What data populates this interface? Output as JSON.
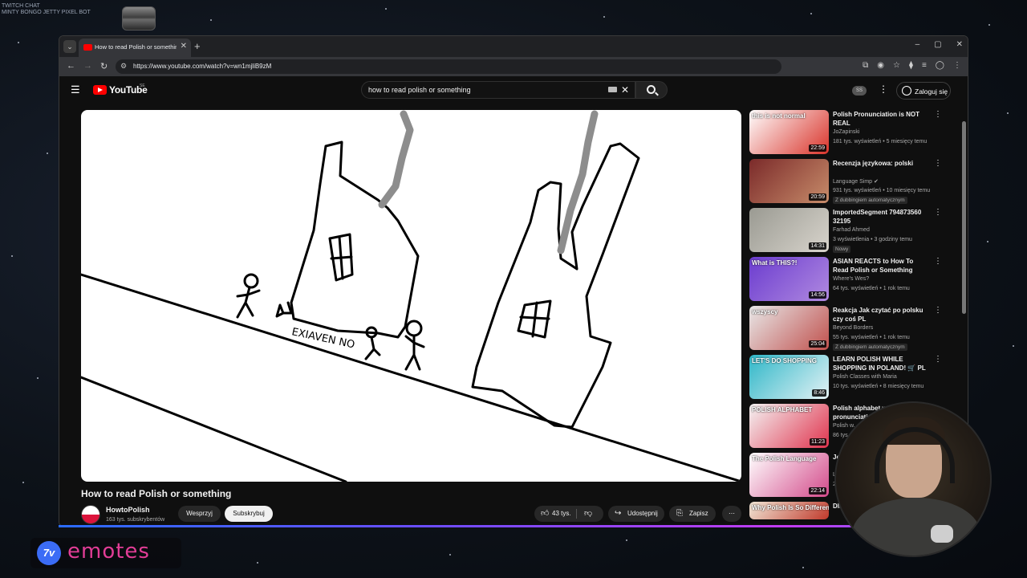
{
  "overlay": {
    "corner_text": "TWITCH CHAT\nMINTY BONGO JETTY PIXEL BOT"
  },
  "browser": {
    "tab_title": "How to read Polish or something",
    "url": "https://www.youtube.com/watch?v=wn1mjliB9zM",
    "window_controls": [
      "–",
      "▢",
      "✕"
    ]
  },
  "youtube": {
    "logo_text": "YouTube",
    "country_code": "SE",
    "search_query": "how to read polish or something",
    "avatar_badge": "SS",
    "sign_in_label": "Zaloguj się"
  },
  "video": {
    "title": "How to read Polish or something",
    "channel": "HowtoPolish",
    "subscribers": "163 tys. subskrybentów",
    "join_label": "Wesprzyj",
    "subscribe_label": "Subskrybuj",
    "likes": "43 tys.",
    "share_label": "Udostępnij",
    "save_label": "Zapisz",
    "drawing_text": "EXIAVEN NO"
  },
  "recommendations": [
    {
      "thumb_text": "this is not normal",
      "duration": "22:59",
      "title": "Polish Pronunciation is NOT REAL",
      "channel": "JoZapinski",
      "meta": "181 tys. wyświetleń • 5 miesięcy temu",
      "badge": "",
      "colors": [
        "#ffffff",
        "#d9342b"
      ]
    },
    {
      "thumb_text": "",
      "duration": "20:59",
      "title": "Recenzja językowa: polski",
      "channel": "Language Simp ✔",
      "meta": "931 tys. wyświetleń • 10 miesięcy temu",
      "badge": "Z dubbingiem automatycznym",
      "colors": [
        "#7b2a2a",
        "#c78c6a"
      ]
    },
    {
      "thumb_text": "",
      "duration": "14:31",
      "title": "ImportedSegment 794873560 32195",
      "channel": "Farhad Ahmed",
      "meta": "3 wyświetlenia • 3 godziny temu",
      "badge": "Nowy",
      "colors": [
        "#9a9a92",
        "#d8d4cc"
      ]
    },
    {
      "thumb_text": "What is THIS?!",
      "duration": "14:56",
      "title": "ASIAN REACTS to How To Read Polish or Something",
      "channel": "Where's Wes?",
      "meta": "64 tys. wyświetleń • 1 rok temu",
      "badge": "",
      "colors": [
        "#6b3ccf",
        "#b089e0"
      ]
    },
    {
      "thumb_text": "wszyscy",
      "duration": "25:04",
      "title": "Reakcja Jak czytać po polsku czy coś PL",
      "channel": "Beyond Borders",
      "meta": "55 tys. wyświetleń • 1 rok temu",
      "badge": "Z dubbingiem automatycznym",
      "colors": [
        "#e8e8e8",
        "#c0504d"
      ]
    },
    {
      "thumb_text": "LET'S DO SHOPPING",
      "duration": "8:46",
      "title": "LEARN POLISH WHILE SHOPPING IN POLAND! 🛒 PL |...",
      "channel": "Polish Classes with Maria",
      "meta": "10 tys. wyświetleń • 8 miesięcy temu",
      "badge": "",
      "colors": [
        "#2fb7c8",
        "#e4f2f5"
      ]
    },
    {
      "thumb_text": "POLISH ALPHABET",
      "duration": "11:23",
      "title": "Polish alphabet w... pronunciation",
      "channel": "Polish w...",
      "meta": "86 tys...",
      "badge": "",
      "colors": [
        "#f4f4f4",
        "#e0334d"
      ]
    },
    {
      "thumb_text": "The Polish Language",
      "duration": "22:14",
      "title": "Język...",
      "channel": "Le...",
      "meta": "2,7...",
      "badge": "",
      "colors": [
        "#ffffff",
        "#d34a8a"
      ]
    },
    {
      "thumb_text": "Why Polish Is So Different?",
      "duration": "",
      "title": "Dlacz... bardz...",
      "channel": "",
      "meta": "",
      "badge": "",
      "colors": [
        "#f1e7d7",
        "#c0392b"
      ]
    }
  ],
  "footer": {
    "emotes_mark": "7v",
    "emotes_text": "emotes"
  }
}
